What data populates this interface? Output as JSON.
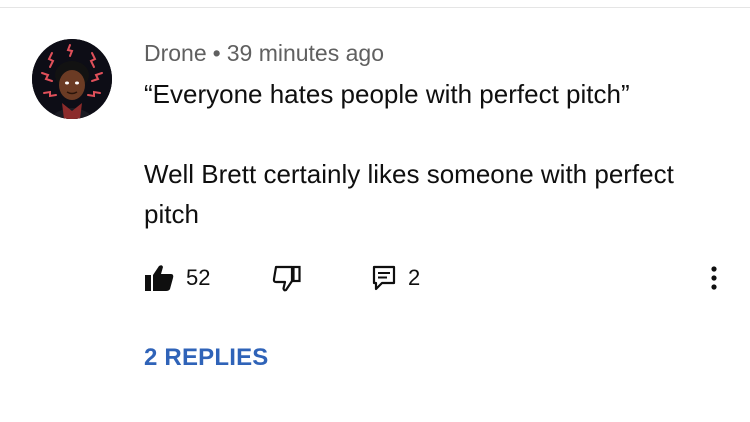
{
  "comment": {
    "author": "Drone",
    "separator": "•",
    "time": "39 minutes ago",
    "text": "“Everyone hates people with perfect pitch”\n\nWell Brett certainly likes someone with perfect pitch"
  },
  "actions": {
    "likes": "52",
    "replies": "2",
    "like_icon": "thumbs-up-icon",
    "dislike_icon": "thumbs-down-icon",
    "reply_icon": "comment-icon",
    "more_icon": "more-vertical-icon"
  },
  "replies_link": "2 REPLIES",
  "colors": {
    "link": "#2f63b8",
    "meta": "#606060",
    "text": "#0f0f0f"
  }
}
